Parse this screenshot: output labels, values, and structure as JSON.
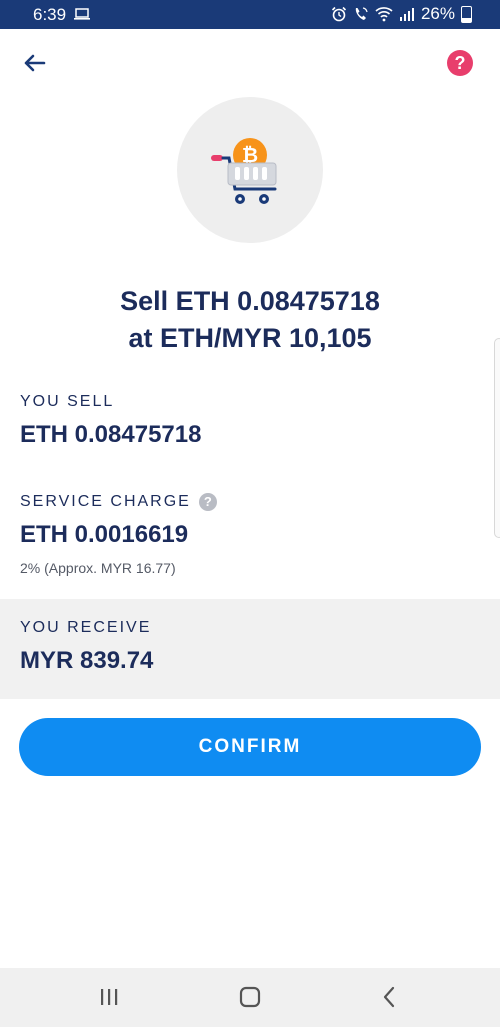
{
  "status_bar": {
    "time": "6:39",
    "battery": "26%",
    "icons": [
      "laptop-icon",
      "alarm-icon",
      "wifi-call-icon",
      "wifi-icon",
      "signal-icon",
      "battery-icon"
    ]
  },
  "header": {
    "back_icon": "arrow-left-icon",
    "help_icon": "question-icon",
    "help_glyph": "?"
  },
  "illustration": {
    "icon": "shopping-cart-bitcoin-icon"
  },
  "title": {
    "line1": "Sell ETH 0.08475718",
    "line2": "at ETH/MYR 10,105"
  },
  "you_sell": {
    "label": "YOU SELL",
    "value": "ETH 0.08475718"
  },
  "service_charge": {
    "label": "SERVICE CHARGE",
    "info_glyph": "?",
    "value": "ETH 0.0016619",
    "note": "2% (Approx. MYR 16.77)"
  },
  "you_receive": {
    "label": "YOU RECEIVE",
    "value": "MYR 839.74"
  },
  "confirm_label": "CONFIRM",
  "colors": {
    "status_bar": "#1a3a78",
    "primary_text": "#1c2c5b",
    "confirm_button": "#0f8cf2",
    "help_button": "#e83e6c",
    "bitcoin": "#f7931a",
    "receive_background": "#f1f1f1"
  },
  "nav_bar": {
    "icons": [
      "recent-apps-icon",
      "home-icon",
      "back-icon"
    ]
  }
}
